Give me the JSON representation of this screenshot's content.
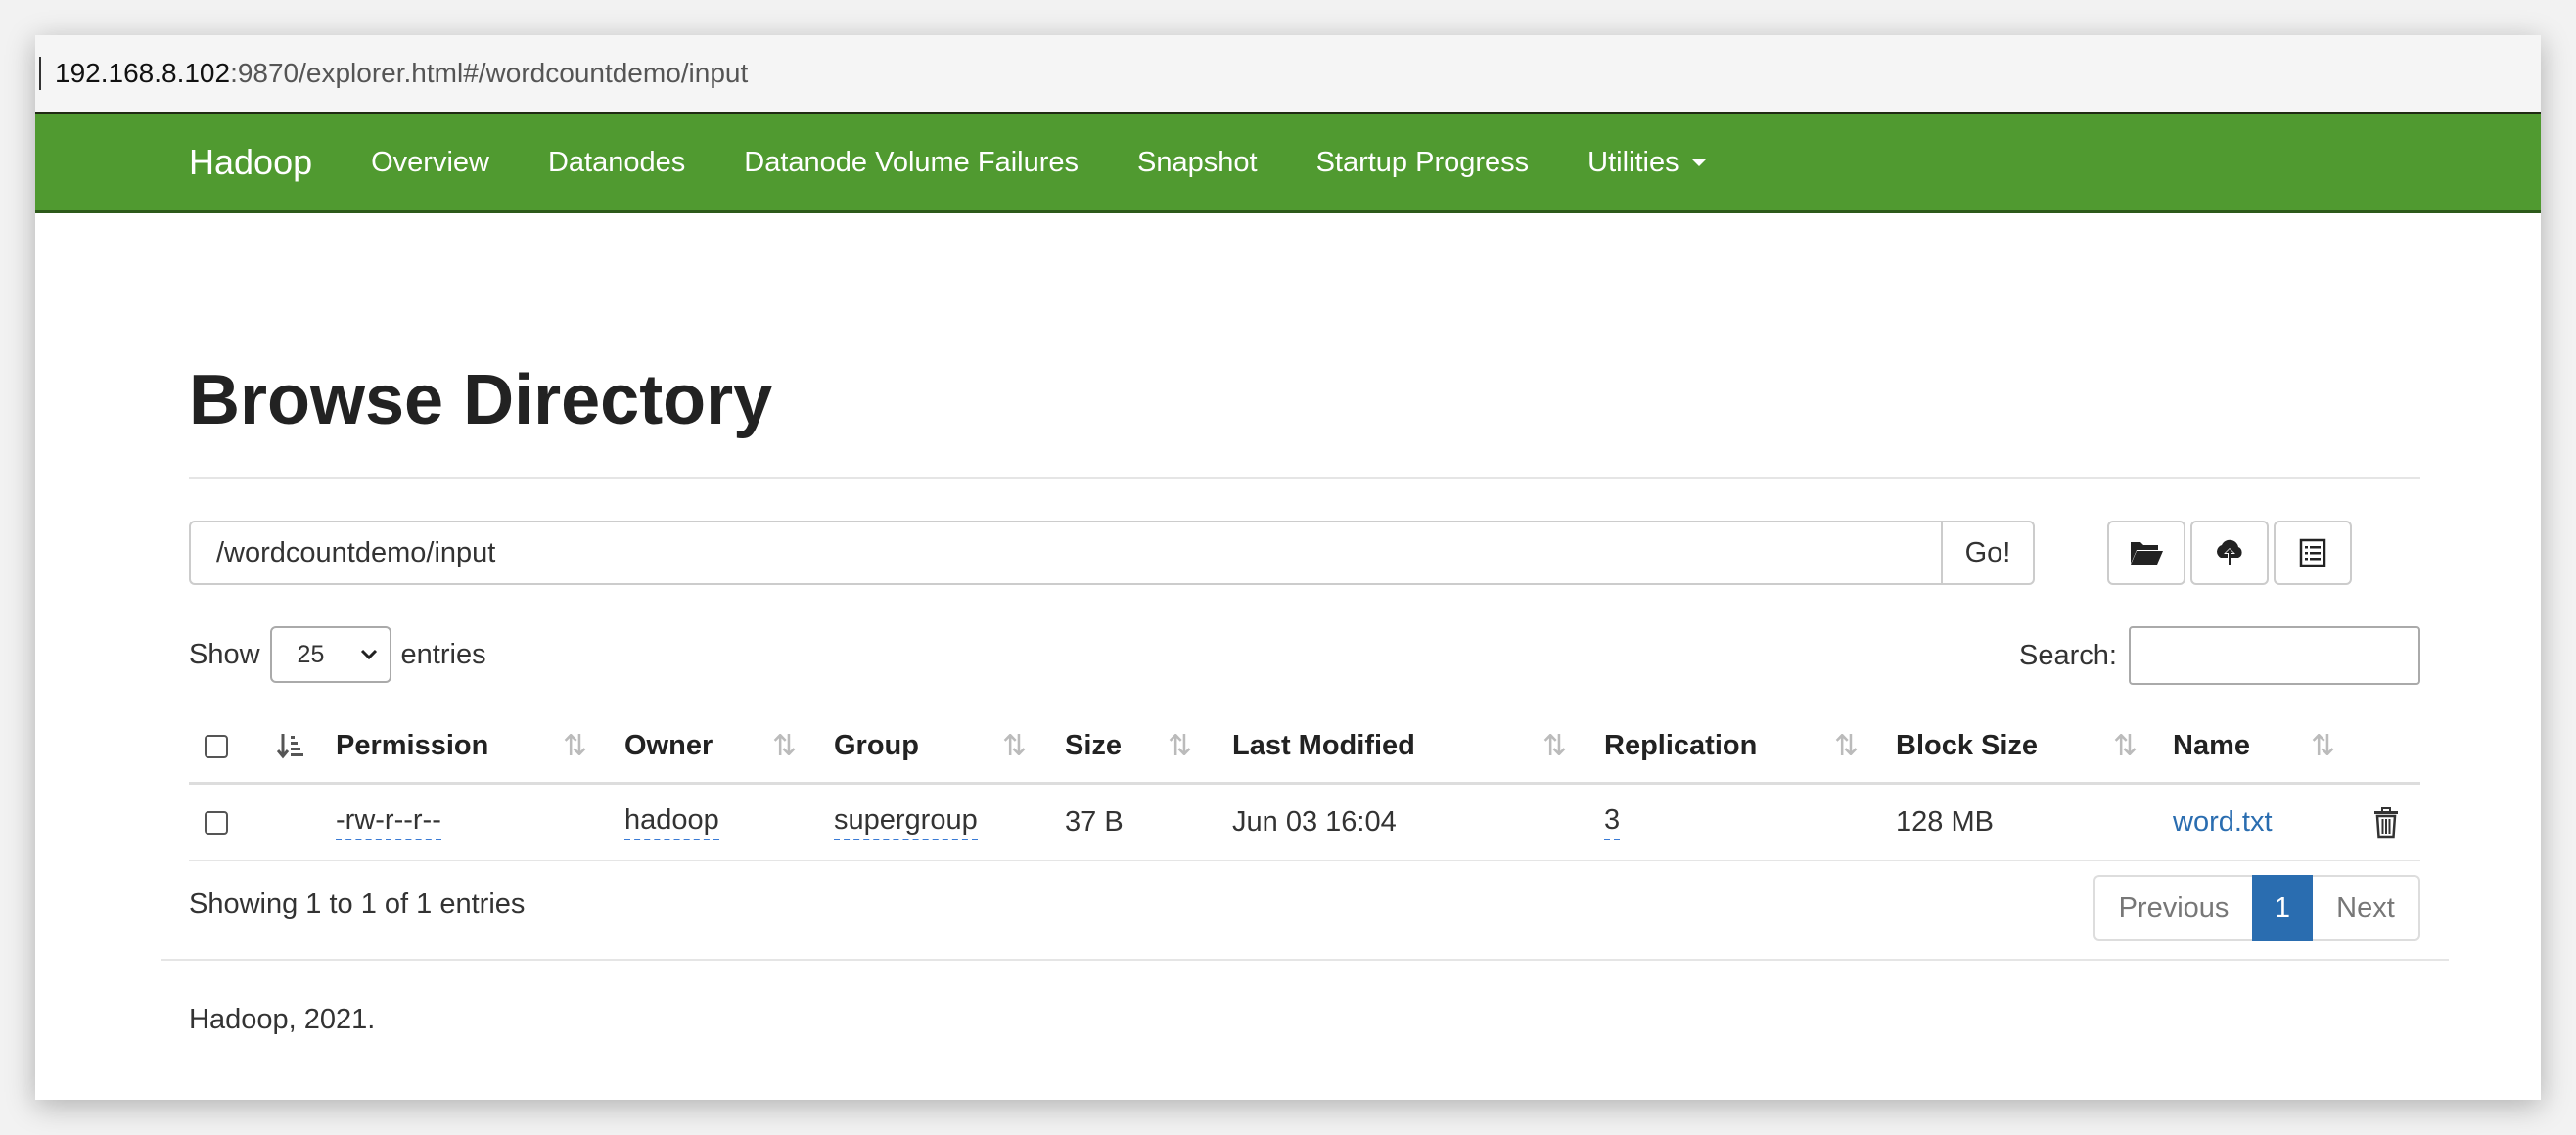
{
  "browser": {
    "url_host": "192.168.8.102",
    "url_rest": ":9870/explorer.html#/wordcountdemo/input"
  },
  "navbar": {
    "brand": "Hadoop",
    "items": [
      {
        "label": "Overview"
      },
      {
        "label": "Datanodes"
      },
      {
        "label": "Datanode Volume Failures"
      },
      {
        "label": "Snapshot"
      },
      {
        "label": "Startup Progress"
      },
      {
        "label": "Utilities"
      }
    ]
  },
  "page": {
    "title": "Browse Directory",
    "path_value": "/wordcountdemo/input",
    "go_label": "Go!",
    "tools": [
      "folder-open-icon",
      "upload-cloud-icon",
      "list-icon"
    ]
  },
  "entries": {
    "show_label": "Show",
    "page_size": "25",
    "entries_label": "entries",
    "search_label": "Search:",
    "search_value": ""
  },
  "table": {
    "headers": [
      "Permission",
      "Owner",
      "Group",
      "Size",
      "Last Modified",
      "Replication",
      "Block Size",
      "Name"
    ],
    "rows": [
      {
        "permission": "-rw-r--r--",
        "owner": "hadoop",
        "group": "supergroup",
        "size": "37 B",
        "modified": "Jun 03 16:04",
        "replication": "3",
        "block_size": "128 MB",
        "name": "word.txt"
      }
    ]
  },
  "pagination": {
    "summary": "Showing 1 to 1 of 1 entries",
    "previous": "Previous",
    "current": "1",
    "next": "Next"
  },
  "footer": {
    "text": "Hadoop, 2021."
  },
  "colors": {
    "navbar": "#509a30",
    "link": "#2a6db0",
    "active_page": "#2a6db0"
  }
}
